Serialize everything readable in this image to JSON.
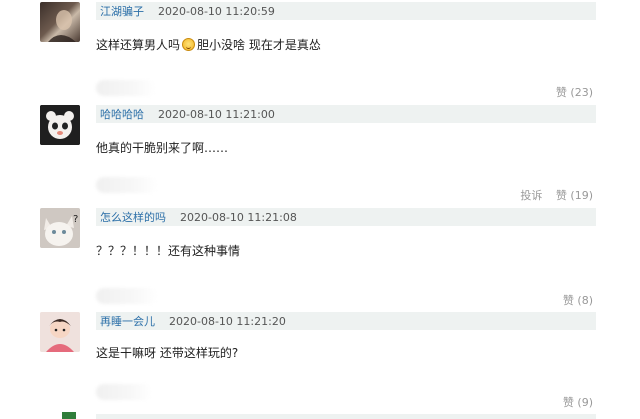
{
  "comments": [
    {
      "username": "江湖骗子",
      "time": "2020-08-10 11:20:59",
      "text_before": "这样还算男人吗",
      "text_after": "胆小没啥 现在才是真怂",
      "emoji": "laughing-emoji",
      "like_label": "赞 (23)",
      "report_label": ""
    },
    {
      "username": "哈哈哈哈",
      "time": "2020-08-10 11:21:00",
      "text": "他真的干脆别来了啊……",
      "like_label": "赞 (19)",
      "report_label": "投诉"
    },
    {
      "username": "怎么这样的吗",
      "time": "2020-08-10 11:21:08",
      "text": "？？？！！！还有这种事情",
      "like_label": "赞 (8)",
      "report_label": ""
    },
    {
      "username": "再睡一会儿",
      "time": "2020-08-10 11:21:20",
      "text": "这是干嘛呀 还带这样玩的?",
      "like_label": "赞 (9)",
      "report_label": ""
    }
  ],
  "colors": {
    "username": "#2b6fa8",
    "name_bar": "#eef2f1",
    "muted": "#999999"
  }
}
